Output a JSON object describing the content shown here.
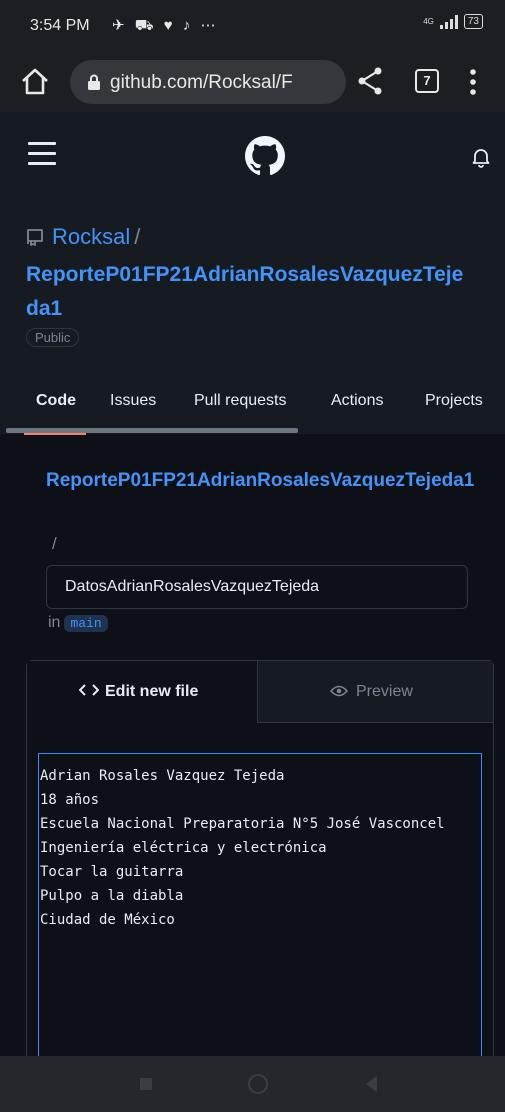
{
  "status_bar": {
    "time": "3:54 PM",
    "notif_icons": "✈ ⛟ ♥ ♪ ⋯",
    "network": "4G",
    "battery": "73"
  },
  "browser": {
    "url": "github.com/Rocksal/F",
    "tab_count": "7"
  },
  "repo": {
    "owner": "Rocksal",
    "separator": "/",
    "name": "ReporteP01FP21AdrianRosalesVazquezTejeda1",
    "visibility": "Public"
  },
  "nav": {
    "tabs": [
      "Code",
      "Issues",
      "Pull requests",
      "Actions",
      "Projects"
    ]
  },
  "editor": {
    "path_repo": "ReporteP01FP21AdrianRosalesVazquezTejeda1",
    "path_separator": "/",
    "filename": "DatosAdrianRosalesVazquezTejeda",
    "branch_prefix": "in",
    "branch": "main",
    "tab_edit": "Edit new file",
    "tab_preview": "Preview",
    "lines": [
      "Adrian Rosales Vazquez Tejeda",
      "18 años",
      "Escuela Nacional Preparatoria N°5 José Vasconcel",
      "Ingeniería eléctrica y electrónica",
      "Tocar la guitarra",
      "Pulpo a la diabla",
      "Ciudad de México"
    ]
  },
  "icons": {
    "home": "home-icon",
    "lock": "lock-icon",
    "share": "share-icon",
    "menu": "more-vert-icon",
    "hamburger": "hamburger-icon",
    "github": "github-logo-icon",
    "bell": "bell-icon",
    "repo": "repo-icon",
    "code": "code-icon",
    "eye": "eye-icon"
  },
  "colors": {
    "link": "#4493f8",
    "accent_underline": "#f78166",
    "bg": "#0d1117",
    "header_bg": "#161b22"
  }
}
